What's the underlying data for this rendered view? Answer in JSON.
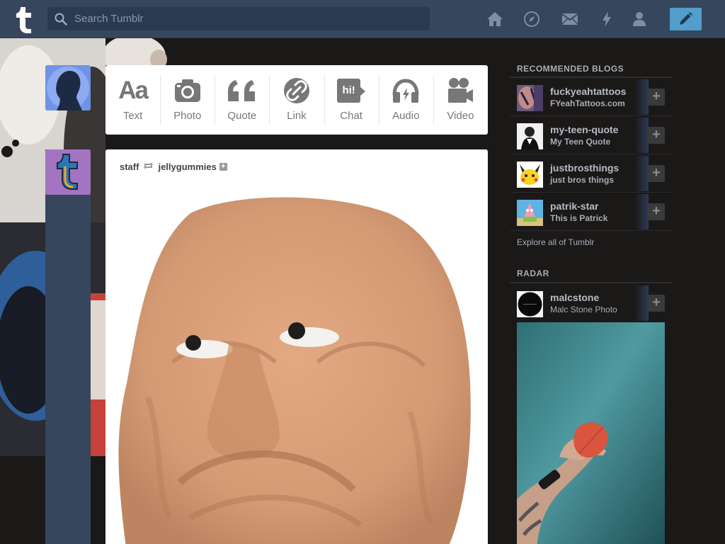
{
  "header": {
    "search_placeholder": "Search Tumblr",
    "nav_icons": [
      "home-icon",
      "explore-icon",
      "inbox-icon",
      "activity-icon",
      "account-icon"
    ],
    "compose_icon": "pencil-icon",
    "colors": {
      "bar": "#36465d",
      "compose": "#529ecc"
    }
  },
  "post_types": [
    {
      "label": "Text",
      "icon": "text-icon",
      "glyph": "Aa"
    },
    {
      "label": "Photo",
      "icon": "camera-icon"
    },
    {
      "label": "Quote",
      "icon": "quote-icon"
    },
    {
      "label": "Link",
      "icon": "link-icon"
    },
    {
      "label": "Chat",
      "icon": "chat-icon",
      "glyph": "hi!"
    },
    {
      "label": "Audio",
      "icon": "headphones-icon"
    },
    {
      "label": "Video",
      "icon": "video-camera-icon"
    }
  ],
  "post": {
    "author": "staff",
    "reblogged_from": "jellygummies",
    "follow_glyph": "+"
  },
  "sidebar": {
    "recommended_title": "RECOMMENDED BLOGS",
    "recommended": [
      {
        "name": "fuckyeahtattoos",
        "title": "FYeahTattoos.com"
      },
      {
        "name": "my-teen-quote",
        "title": "My Teen Quote"
      },
      {
        "name": "justbrosthings",
        "title": "just bros things"
      },
      {
        "name": "patrik-star",
        "title": "This is Patrick"
      }
    ],
    "explore_label": "Explore all of Tumblr",
    "radar_title": "RADAR",
    "radar": {
      "name": "malcstone",
      "title": "Malc Stone Photo"
    },
    "add_glyph": "+"
  }
}
